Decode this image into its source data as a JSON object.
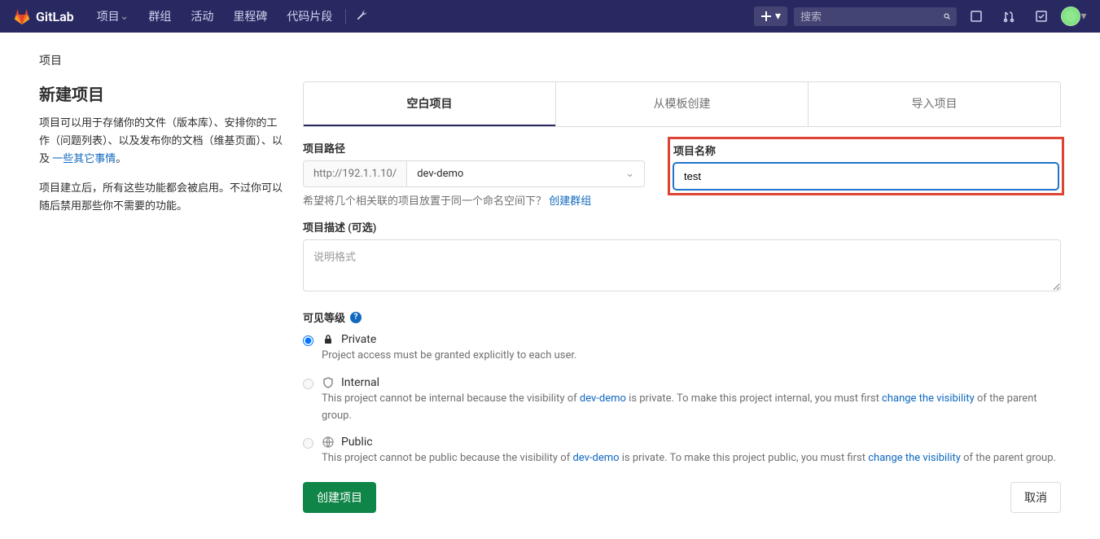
{
  "brand": "GitLab",
  "nav": {
    "project": "项目",
    "groups": "群组",
    "activity": "活动",
    "milestones": "里程碑",
    "snippets": "代码片段"
  },
  "search": {
    "placeholder": "搜索"
  },
  "breadcrumb": "项目",
  "page": {
    "title": "新建项目",
    "desc1_a": "项目可以用于存储你的文件（版本库）、安排你的工作（问题列表）、以及发布你的文档（维基页面）、以及 ",
    "desc1_link": "一些其它事情",
    "desc1_b": "。",
    "desc2": "项目建立后，所有这些功能都会被启用。不过你可以随后禁用那些你不需要的功能。"
  },
  "tabs": {
    "blank": "空白项目",
    "template": "从模板创建",
    "import": "导入项目"
  },
  "form": {
    "path_label": "项目路径",
    "url_prefix": "http://192.1.1.10/",
    "namespace": "dev-demo",
    "name_label": "项目名称",
    "name_value": "test",
    "hint_a": "希望将几个相关联的项目放置于同一个命名空间下？ ",
    "hint_link": "创建群组",
    "desc_label": "项目描述 (可选)",
    "desc_placeholder": "说明格式",
    "visibility_label": "可见等级",
    "vis": {
      "private": {
        "title": "Private",
        "desc": "Project access must be granted explicitly to each user."
      },
      "internal": {
        "title": "Internal",
        "desc_a": "This project cannot be internal because the visibility of ",
        "desc_ns": "dev-demo",
        "desc_b": " is private. To make this project internal, you must first ",
        "desc_link": "change the visibility",
        "desc_c": " of the parent group."
      },
      "public": {
        "title": "Public",
        "desc_a": "This project cannot be public because the visibility of ",
        "desc_ns": "dev-demo",
        "desc_b": " is private. To make this project public, you must first ",
        "desc_link": "change the visibility",
        "desc_c": " of the parent group."
      }
    },
    "submit": "创建项目",
    "cancel": "取消"
  }
}
